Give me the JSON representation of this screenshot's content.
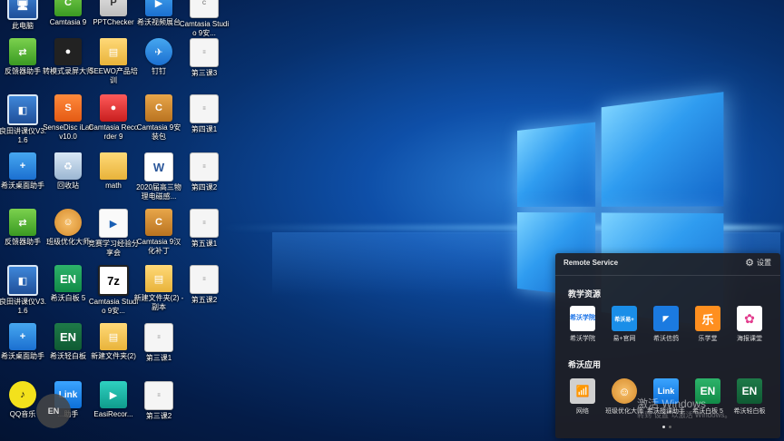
{
  "desktop": {
    "icons": [
      {
        "label": "此电脑",
        "symbol": "🖥"
      },
      {
        "label": "Camtasia 9",
        "symbol": "C"
      },
      {
        "label": "PPTChecker",
        "symbol": "P"
      },
      {
        "label": "希沃视频展台",
        "symbol": "▶"
      },
      {
        "label": "Camtasia Studio 9安...",
        "symbol": "C"
      },
      {
        "label": "反馈器助手",
        "symbol": "⇄"
      },
      {
        "label": "转模式录屏大师",
        "symbol": "●"
      },
      {
        "label": "SEEWO产品培训",
        "symbol": "▤"
      },
      {
        "label": "钉钉",
        "symbol": "✈"
      },
      {
        "label": "第三课3",
        "symbol": "≡"
      },
      {
        "label": "良田讲课仪V3.1.6",
        "symbol": "◧"
      },
      {
        "label": "SenseDisc iLab v10.0",
        "symbol": "S"
      },
      {
        "label": "Camtasia Recorder 9",
        "symbol": "●"
      },
      {
        "label": "Camtasia 9安装包",
        "symbol": "C"
      },
      {
        "label": "第四课1",
        "symbol": "≡"
      },
      {
        "label": "希沃桌面助手",
        "symbol": "+"
      },
      {
        "label": "回收站",
        "symbol": "♻"
      },
      {
        "label": "math",
        "symbol": ""
      },
      {
        "label": "2020届高三物理电磁感...",
        "symbol": "W"
      },
      {
        "label": "第四课2",
        "symbol": "≡"
      },
      {
        "label": "反馈器助手",
        "symbol": "⇄"
      },
      {
        "label": "班级优化大师",
        "symbol": "☺"
      },
      {
        "label": "竞赛学习经验分享会",
        "symbol": "▶"
      },
      {
        "label": "Camtasia 9汉化补丁",
        "symbol": "C"
      },
      {
        "label": "第五课1",
        "symbol": "≡"
      },
      {
        "label": "良田讲课仪V3.1.6",
        "symbol": "◧"
      },
      {
        "label": "希沃白板 5",
        "symbol": "EN"
      },
      {
        "label": "Camtasia Studio 9安...",
        "symbol": "7z"
      },
      {
        "label": "新建文件夹(2) - 副本",
        "symbol": "▤"
      },
      {
        "label": "第五课2",
        "symbol": "≡"
      },
      {
        "label": "希沃桌面助手",
        "symbol": "+"
      },
      {
        "label": "希沃轻白板",
        "symbol": "EN"
      },
      {
        "label": "新建文件夹(2)",
        "symbol": "▤"
      },
      {
        "label": "第三课1",
        "symbol": "≡"
      },
      {
        "label": "QQ音乐",
        "symbol": "♪"
      },
      {
        "label": "...助手",
        "symbol": "Link"
      },
      {
        "label": "EasiRecor...",
        "symbol": "▶"
      },
      {
        "label": "第三课2",
        "symbol": "≡"
      }
    ],
    "floating_button": "EN"
  },
  "remote_panel": {
    "title": "Remote Service",
    "settings_label": "设置",
    "section1_title": "教学资源",
    "section1_apps": [
      {
        "label": "希沃学院",
        "symbol": "希沃学院"
      },
      {
        "label": "易+官网",
        "symbol": "希沃易+"
      },
      {
        "label": "希沃信鸽",
        "symbol": "◤"
      },
      {
        "label": "乐学堂",
        "symbol": "乐"
      },
      {
        "label": "海报课堂",
        "symbol": "✿"
      }
    ],
    "section2_title": "希沃应用",
    "section2_apps": [
      {
        "label": "网络",
        "symbol": "📶"
      },
      {
        "label": "班级优化大师",
        "symbol": "☺"
      },
      {
        "label": "希沃授课助手",
        "symbol": "Link"
      },
      {
        "label": "希沃白板 5",
        "symbol": "EN"
      },
      {
        "label": "希沃轻白板",
        "symbol": "EN"
      }
    ]
  },
  "watermark": {
    "line1": "激活 Windows",
    "line2": "转到\"设置\"以激活 Windows。"
  },
  "colors": {
    "wallpaper_blue": "#0e4fa8",
    "panel_bg": "#1e1e24"
  }
}
